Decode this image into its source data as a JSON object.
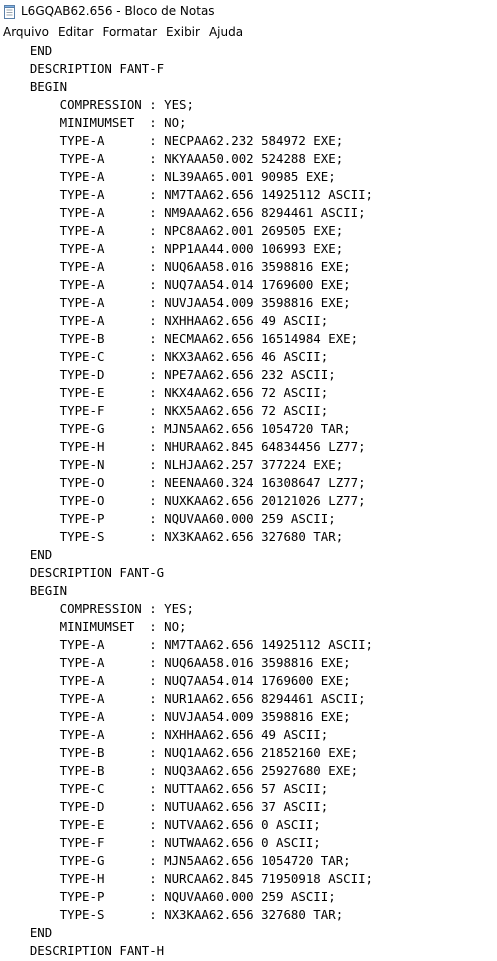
{
  "window": {
    "title": "L6GQAB62.656 - Bloco de Notas",
    "app_icon": "notepad-icon"
  },
  "menu": {
    "items": [
      "Arquivo",
      "Editar",
      "Formatar",
      "Exibir",
      "Ajuda"
    ]
  },
  "document": {
    "lines": [
      "    END",
      "    DESCRIPTION FANT-F",
      "    BEGIN",
      "        COMPRESSION : YES;",
      "        MINIMUMSET  : NO;",
      "        TYPE-A      : NECPAA62.232 584972 EXE;",
      "        TYPE-A      : NKYAAA50.002 524288 EXE;",
      "        TYPE-A      : NL39AA65.001 90985 EXE;",
      "        TYPE-A      : NM7TAA62.656 14925112 ASCII;",
      "        TYPE-A      : NM9AAA62.656 8294461 ASCII;",
      "        TYPE-A      : NPC8AA62.001 269505 EXE;",
      "        TYPE-A      : NPP1AA44.000 106993 EXE;",
      "        TYPE-A      : NUQ6AA58.016 3598816 EXE;",
      "        TYPE-A      : NUQ7AA54.014 1769600 EXE;",
      "        TYPE-A      : NUVJAA54.009 3598816 EXE;",
      "        TYPE-A      : NXHHAA62.656 49 ASCII;",
      "        TYPE-B      : NECMAA62.656 16514984 EXE;",
      "        TYPE-C      : NKX3AA62.656 46 ASCII;",
      "        TYPE-D      : NPE7AA62.656 232 ASCII;",
      "        TYPE-E      : NKX4AA62.656 72 ASCII;",
      "        TYPE-F      : NKX5AA62.656 72 ASCII;",
      "        TYPE-G      : MJN5AA62.656 1054720 TAR;",
      "        TYPE-H      : NHURAA62.845 64834456 LZ77;",
      "        TYPE-N      : NLHJAA62.257 377224 EXE;",
      "        TYPE-O      : NEENAA60.324 16308647 LZ77;",
      "        TYPE-O      : NUXKAA62.656 20121026 LZ77;",
      "        TYPE-P      : NQUVAA60.000 259 ASCII;",
      "        TYPE-S      : NX3KAA62.656 327680 TAR;",
      "    END",
      "    DESCRIPTION FANT-G",
      "    BEGIN",
      "        COMPRESSION : YES;",
      "        MINIMUMSET  : NO;",
      "        TYPE-A      : NM7TAA62.656 14925112 ASCII;",
      "        TYPE-A      : NUQ6AA58.016 3598816 EXE;",
      "        TYPE-A      : NUQ7AA54.014 1769600 EXE;",
      "        TYPE-A      : NUR1AA62.656 8294461 ASCII;",
      "        TYPE-A      : NUVJAA54.009 3598816 EXE;",
      "        TYPE-A      : NXHHAA62.656 49 ASCII;",
      "        TYPE-B      : NUQ1AA62.656 21852160 EXE;",
      "        TYPE-B      : NUQ3AA62.656 25927680 EXE;",
      "        TYPE-C      : NUTTAA62.656 57 ASCII;",
      "        TYPE-D      : NUTUAA62.656 37 ASCII;",
      "        TYPE-E      : NUTVAA62.656 0 ASCII;",
      "        TYPE-F      : NUTWAA62.656 0 ASCII;",
      "        TYPE-G      : MJN5AA62.656 1054720 TAR;",
      "        TYPE-H      : NURCAA62.845 71950918 ASCII;",
      "        TYPE-P      : NQUVAA60.000 259 ASCII;",
      "        TYPE-S      : NX3KAA62.656 327680 TAR;",
      "    END",
      "    DESCRIPTION FANT-H"
    ]
  }
}
